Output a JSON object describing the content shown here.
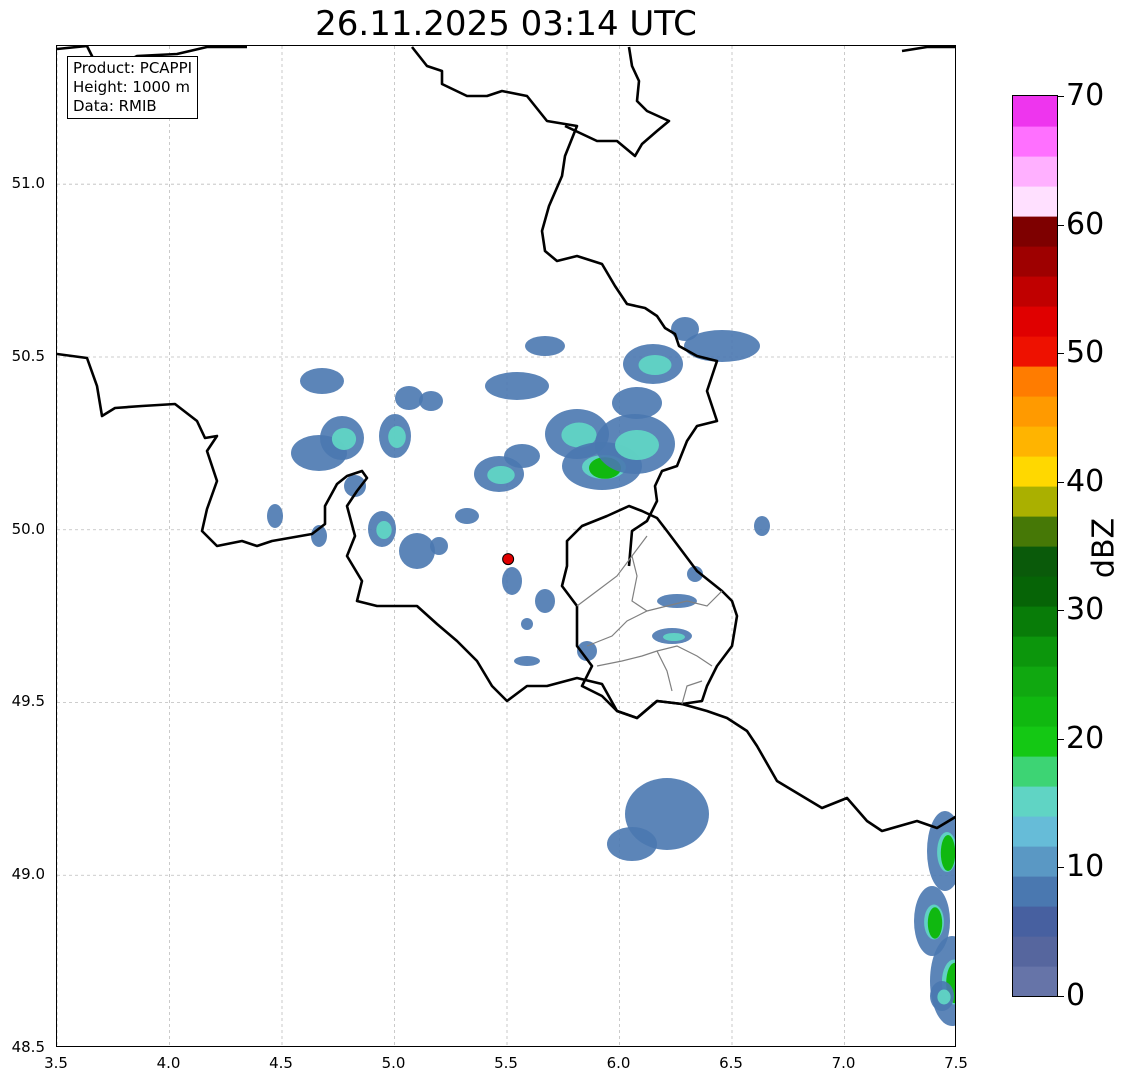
{
  "title": "26.11.2025 03:14 UTC",
  "info": {
    "product": "Product: PCAPPI",
    "height": "Height: 1000 m",
    "data": "Data: RMIB"
  },
  "map": {
    "lon_range": [
      3.5,
      7.5
    ],
    "lat_range": [
      48.5,
      51.4
    ],
    "x_ticks": [
      "3.5",
      "4.0",
      "4.5",
      "5.0",
      "5.5",
      "6.0",
      "6.5",
      "7.0",
      "7.5"
    ],
    "y_ticks": [
      "48.5",
      "49.0",
      "49.5",
      "50.0",
      "50.5",
      "51.0"
    ],
    "grid": true,
    "radar_site": {
      "lon": 5.505,
      "lat": 49.915,
      "color": "#e00000"
    }
  },
  "colorbar": {
    "label": "dBZ",
    "range": [
      0,
      70
    ],
    "ticks": [
      "0",
      "10",
      "20",
      "30",
      "40",
      "50",
      "60",
      "70"
    ],
    "colors": [
      "#6674a8",
      "#56669e",
      "#4760a0",
      "#4a78b0",
      "#5a98c4",
      "#66bcd8",
      "#60d4c4",
      "#3dd474",
      "#14c814",
      "#10b810",
      "#10a810",
      "#0c960c",
      "#087c08",
      "#066406",
      "#0a5a0a",
      "#467806",
      "#aab000",
      "#ffd800",
      "#ffb400",
      "#ff9a00",
      "#ff7c00",
      "#ee1100",
      "#e00000",
      "#c00000",
      "#9e0000",
      "#7e0000",
      "#ffe0ff",
      "#ffb0ff",
      "#ff70ff",
      "#ee35ee"
    ]
  }
}
